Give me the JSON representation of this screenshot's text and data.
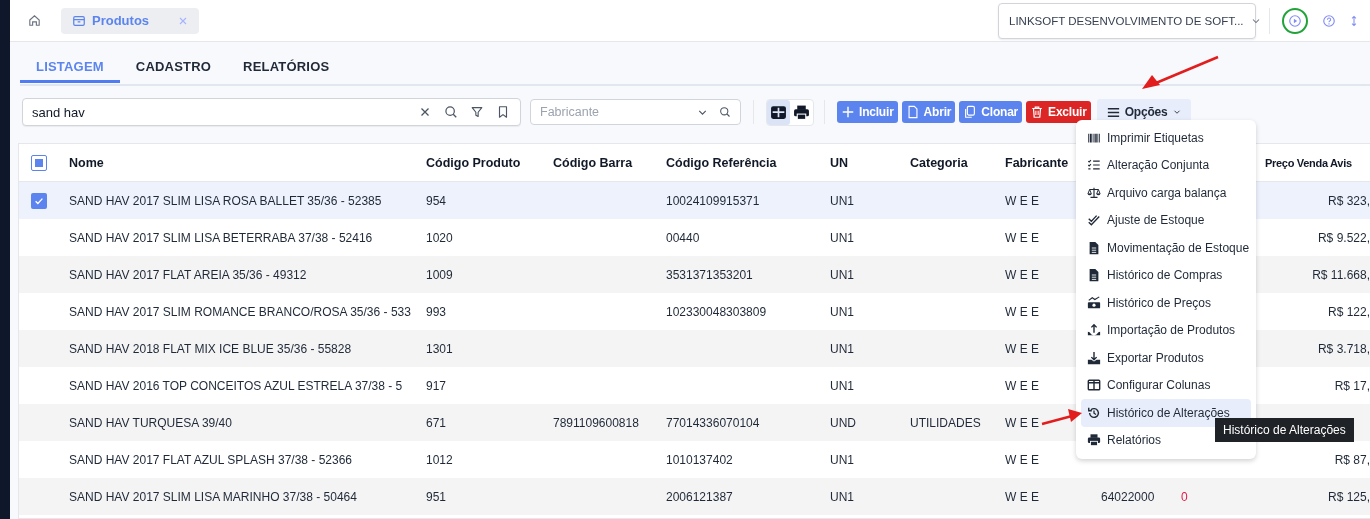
{
  "app_tabs": [
    {
      "label": "Produtos",
      "selected": true
    }
  ],
  "company_select": {
    "value": "LINKSOFT DESENVOLVIMENTO DE SOFT..."
  },
  "page_tabs": [
    {
      "label": "LISTAGEM",
      "selected": true
    },
    {
      "label": "CADASTRO",
      "selected": false
    },
    {
      "label": "RELATÓRIOS",
      "selected": false
    }
  ],
  "search": {
    "value": "sand hav"
  },
  "manufacturer_filter": {
    "placeholder": "Fabricante"
  },
  "view_toggles": [
    {
      "selected": true
    },
    {
      "selected": false
    }
  ],
  "actions": [
    {
      "label": "Incluir",
      "kind": "primary"
    },
    {
      "label": "Abrir",
      "kind": "primary"
    },
    {
      "label": "Clonar",
      "kind": "primary"
    },
    {
      "label": "Excluir",
      "kind": "danger"
    },
    {
      "label": "Opções",
      "kind": "menu"
    }
  ],
  "table": {
    "select_all_indeterminate": true,
    "columns": [
      "Nome",
      "Código Produto",
      "Código Barra",
      "Código Referência",
      "UN",
      "Categoria",
      "Fabricante",
      "Preço Venda Avis"
    ],
    "rows": [
      {
        "selected": true,
        "name": "SAND HAV 2017 SLIM LISA ROSA BALLET 35/36 - 52385",
        "code": "954",
        "reference": "10024109915371",
        "unit": "UN1",
        "manufacturer": "W E E",
        "price": "R$ 323,"
      },
      {
        "selected": false,
        "name": "SAND HAV 2017 SLIM LISA BETERRABA 37/38 - 52416",
        "code": "1020",
        "reference": "00440",
        "unit": "UN1",
        "manufacturer": "W E E",
        "price": "R$ 9.522,"
      },
      {
        "selected": false,
        "name": "SAND HAV 2017 FLAT AREIA 35/36 - 49312",
        "code": "1009",
        "reference": "3531371353201",
        "unit": "UN1",
        "manufacturer": "W E E",
        "price": "R$ 11.668,"
      },
      {
        "selected": false,
        "name": "SAND HAV 2017 SLIM ROMANCE BRANCO/ROSA 35/36 - 533",
        "code": "993",
        "reference": "102330048303809",
        "unit": "UN1",
        "manufacturer": "W E E",
        "price": "R$ 122,"
      },
      {
        "selected": false,
        "name": "SAND HAV 2018 FLAT MIX ICE BLUE 35/36 - 55828",
        "code": "1301",
        "unit": "UN1",
        "manufacturer": "W E E",
        "price": "R$ 3.718,"
      },
      {
        "selected": false,
        "name": "SAND HAV 2016 TOP CONCEITOS AZUL ESTRELA 37/38 - 5",
        "code": "917",
        "unit": "UN1",
        "manufacturer": "W E E",
        "price": "R$ 17,"
      },
      {
        "selected": false,
        "name": "SAND HAV TURQUESA 39/40",
        "code": "671",
        "barcode": "7891109600818",
        "reference": "77014336070104",
        "unit": "UND",
        "category": "UTILIDADES",
        "manufacturer": "W E E"
      },
      {
        "selected": false,
        "name": "SAND HAV 2017 FLAT AZUL SPLASH 37/38 - 52366",
        "code": "1012",
        "reference": "1010137402",
        "unit": "UN1",
        "manufacturer": "W E E",
        "price": "R$ 87,"
      },
      {
        "selected": false,
        "name": "SAND HAV 2017 SLIM LISA MARINHO 37/38 - 50464",
        "code": "951",
        "reference": "2006121387",
        "unit": "UN1",
        "manufacturer": "W E E",
        "column_8": "64022000",
        "column_9": "0",
        "price": "R$ 125,"
      }
    ]
  },
  "options_menu": {
    "items": [
      {
        "label": "Imprimir Etiquetas",
        "selected": false
      },
      {
        "label": "Alteração Conjunta",
        "selected": false
      },
      {
        "label": "Arquivo carga balança",
        "selected": false
      },
      {
        "label": "Ajuste de Estoque",
        "selected": false
      },
      {
        "label": "Movimentação de Estoque",
        "selected": false
      },
      {
        "label": "Histórico de Compras",
        "selected": false
      },
      {
        "label": "Histórico de Preços",
        "selected": false
      },
      {
        "label": "Importação de Produtos",
        "selected": false
      },
      {
        "label": "Exportar Produtos",
        "selected": false
      },
      {
        "label": "Configurar Colunas",
        "selected": false
      },
      {
        "label": "Histórico de Alterações",
        "selected": true
      },
      {
        "label": "Relatórios",
        "selected": false
      }
    ],
    "tooltip": "Histórico de Alterações"
  }
}
